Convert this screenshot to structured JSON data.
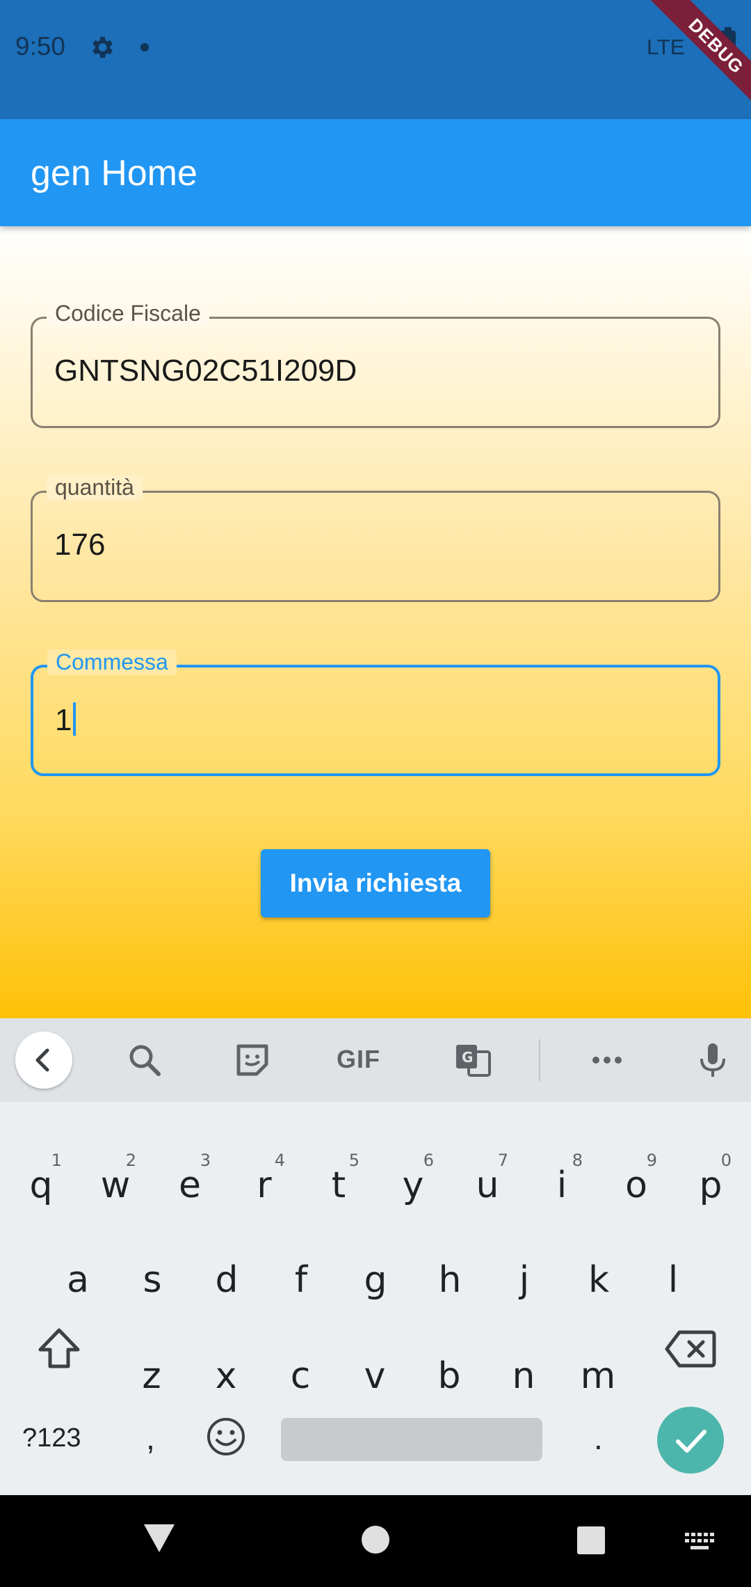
{
  "status_bar": {
    "time": "9:50",
    "network": "LTE",
    "debug_banner": "DEBUG"
  },
  "app_bar": {
    "title": "gen Home"
  },
  "form": {
    "codice_fiscale": {
      "label": "Codice Fiscale",
      "value": "GNTSNG02C51I209D"
    },
    "quantita": {
      "label": "quantità",
      "value": "176"
    },
    "commessa": {
      "label": "Commessa",
      "value": "1"
    },
    "submit_label": "Invia richiesta"
  },
  "keyboard": {
    "toolbar": {
      "gif_label": "GIF"
    },
    "row1": [
      {
        "char": "q",
        "hint": "1"
      },
      {
        "char": "w",
        "hint": "2"
      },
      {
        "char": "e",
        "hint": "3"
      },
      {
        "char": "r",
        "hint": "4"
      },
      {
        "char": "t",
        "hint": "5"
      },
      {
        "char": "y",
        "hint": "6"
      },
      {
        "char": "u",
        "hint": "7"
      },
      {
        "char": "i",
        "hint": "8"
      },
      {
        "char": "o",
        "hint": "9"
      },
      {
        "char": "p",
        "hint": "0"
      }
    ],
    "row2": [
      "a",
      "s",
      "d",
      "f",
      "g",
      "h",
      "j",
      "k",
      "l"
    ],
    "row3": [
      "z",
      "x",
      "c",
      "v",
      "b",
      "n",
      "m"
    ],
    "symbols_label": "?123",
    "comma": ",",
    "period": "."
  },
  "colors": {
    "primary": "#2196f3",
    "status_bar": "#1c6fb8",
    "enter_key": "#4db6ac",
    "debug": "#7b1f3a"
  }
}
